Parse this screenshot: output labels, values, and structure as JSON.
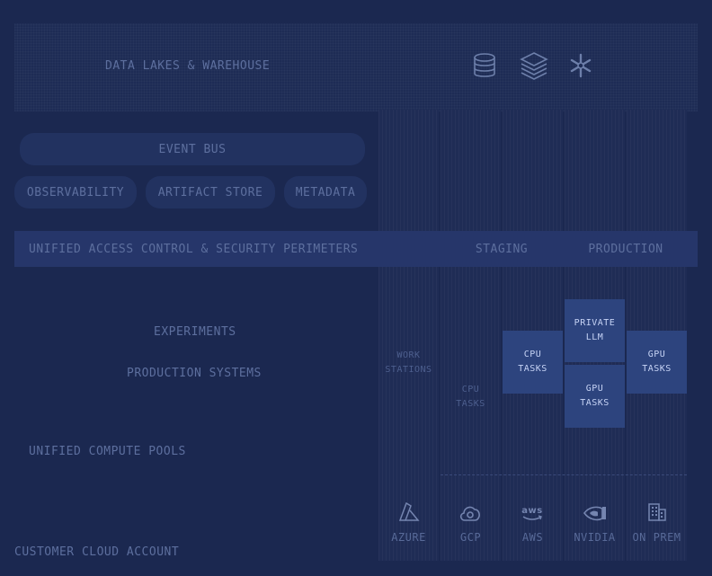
{
  "data_lakes": {
    "title": "DATA LAKES & WAREHOUSE",
    "icons": [
      "database-icon",
      "layers-icon",
      "snowflake-icon"
    ]
  },
  "event_bus": {
    "label": "EVENT BUS"
  },
  "services": {
    "observability": "OBSERVABILITY",
    "artifact_store": "ARTIFACT STORE",
    "metadata": "METADATA"
  },
  "access_control": {
    "title": "UNIFIED ACCESS CONTROL & SECURITY PERIMETERS"
  },
  "environments": {
    "staging": "STAGING",
    "production": "PRODUCTION"
  },
  "workloads": {
    "experiments": "EXPERIMENTS",
    "production_systems": "PRODUCTION SYSTEMS"
  },
  "compute_pools": {
    "label": "UNIFIED COMPUTE POOLS"
  },
  "customer_account": {
    "label": "CUSTOMER CLOUD ACCOUNT"
  },
  "tasks": {
    "workstations": [
      "WORK",
      "STATIONS"
    ],
    "gcp_cpu": [
      "CPU",
      "TASKS"
    ],
    "aws_cpu": [
      "CPU",
      "TASKS"
    ],
    "private_llm": [
      "PRIVATE",
      "LLM"
    ],
    "nvidia_gpu": [
      "GPU",
      "TASKS"
    ],
    "onprem_gpu": [
      "GPU",
      "TASKS"
    ]
  },
  "providers": [
    {
      "name": "AZURE",
      "icon": "azure-icon"
    },
    {
      "name": "GCP",
      "icon": "gcp-cloud-icon"
    },
    {
      "name": "AWS",
      "icon": "aws-icon"
    },
    {
      "name": "NVIDIA",
      "icon": "nvidia-icon"
    },
    {
      "name": "ON PREM",
      "icon": "building-icon"
    }
  ],
  "colors": {
    "background": "#1b2850",
    "band": "#26366a",
    "task_active": "#2d447e",
    "text": "#5d6f9e",
    "task_text": "#c6d3f5"
  }
}
